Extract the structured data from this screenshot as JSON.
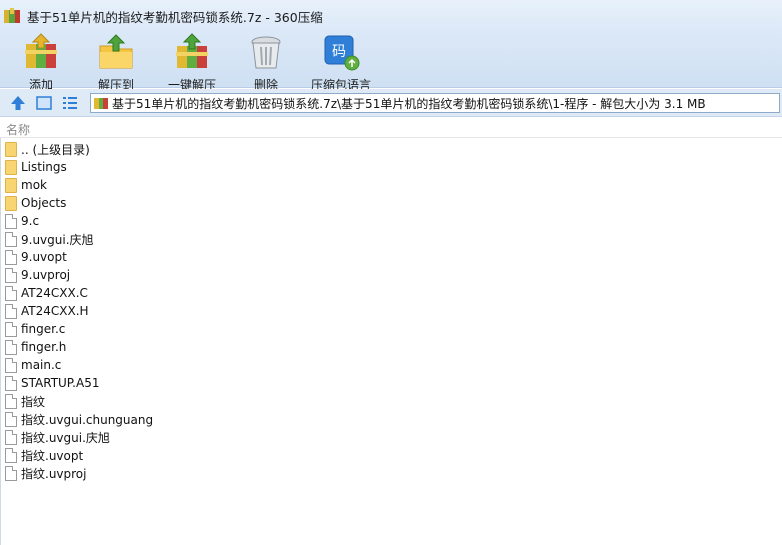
{
  "window": {
    "title": "基于51单片机的指纹考勤机密码锁系统.7z - 360压缩"
  },
  "toolbar": {
    "add_label": "添加",
    "extract_label": "解压到",
    "one_click_label": "一键解压",
    "delete_label": "删除",
    "encoding_label": "压缩包语言"
  },
  "address": {
    "path": "基于51单片机的指纹考勤机密码锁系统.7z\\基于51单片机的指纹考勤机密码锁系统\\1-程序 - 解包大小为 3.1 MB"
  },
  "list": {
    "column_name": "名称",
    "items": [
      {
        "name": ".. (上级目录)",
        "type": "folder"
      },
      {
        "name": "Listings",
        "type": "folder"
      },
      {
        "name": "mok",
        "type": "folder"
      },
      {
        "name": "Objects",
        "type": "folder"
      },
      {
        "name": "9.c",
        "type": "file"
      },
      {
        "name": "9.uvgui.庆旭",
        "type": "file"
      },
      {
        "name": "9.uvopt",
        "type": "file"
      },
      {
        "name": "9.uvproj",
        "type": "file"
      },
      {
        "name": "AT24CXX.C",
        "type": "file"
      },
      {
        "name": "AT24CXX.H",
        "type": "file"
      },
      {
        "name": "finger.c",
        "type": "file"
      },
      {
        "name": "finger.h",
        "type": "file"
      },
      {
        "name": "main.c",
        "type": "file"
      },
      {
        "name": "STARTUP.A51",
        "type": "file"
      },
      {
        "name": "指纹",
        "type": "file"
      },
      {
        "name": "指纹.uvgui.chunguang",
        "type": "file"
      },
      {
        "name": "指纹.uvgui.庆旭",
        "type": "file"
      },
      {
        "name": "指纹.uvopt",
        "type": "file"
      },
      {
        "name": "指纹.uvproj",
        "type": "file"
      }
    ]
  },
  "colors": {
    "folder": "#f8d571",
    "toolbar_bg": "#d4e3f5",
    "accent_blue": "#2f7fd8"
  }
}
